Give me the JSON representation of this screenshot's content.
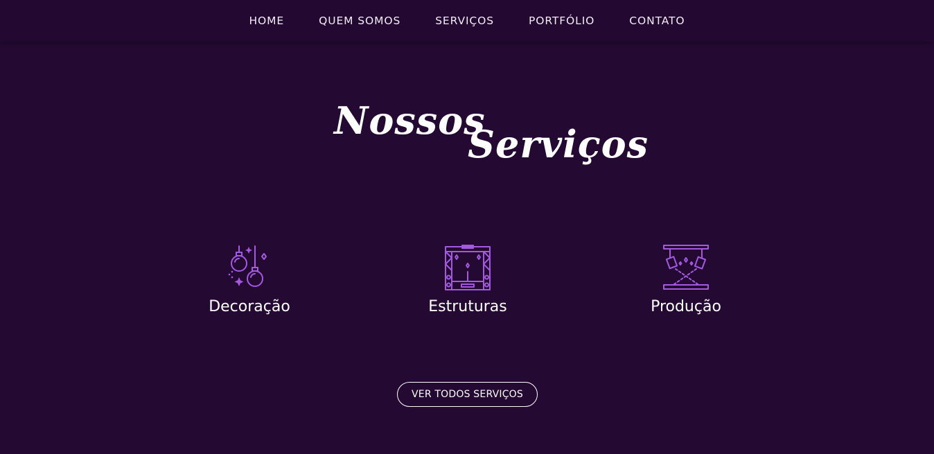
{
  "nav": {
    "items": [
      {
        "label": "HOME"
      },
      {
        "label": "QUEM SOMOS"
      },
      {
        "label": "SERVIÇOS"
      },
      {
        "label": "PORTFÓLIO"
      },
      {
        "label": "CONTATO"
      }
    ]
  },
  "section": {
    "title_line1": "Nossos",
    "title_line2": "Serviços"
  },
  "services": [
    {
      "label": "Decoração",
      "icon": "hanging-ornaments-icon"
    },
    {
      "label": "Estruturas",
      "icon": "stage-truss-icon"
    },
    {
      "label": "Produção",
      "icon": "stage-lights-icon"
    }
  ],
  "cta": {
    "label": "VER TODOS SERVIÇOS"
  },
  "colors": {
    "background": "#240a33",
    "navbar": "#230932",
    "icon_accent": "#a459e0",
    "text": "#ffffff"
  }
}
